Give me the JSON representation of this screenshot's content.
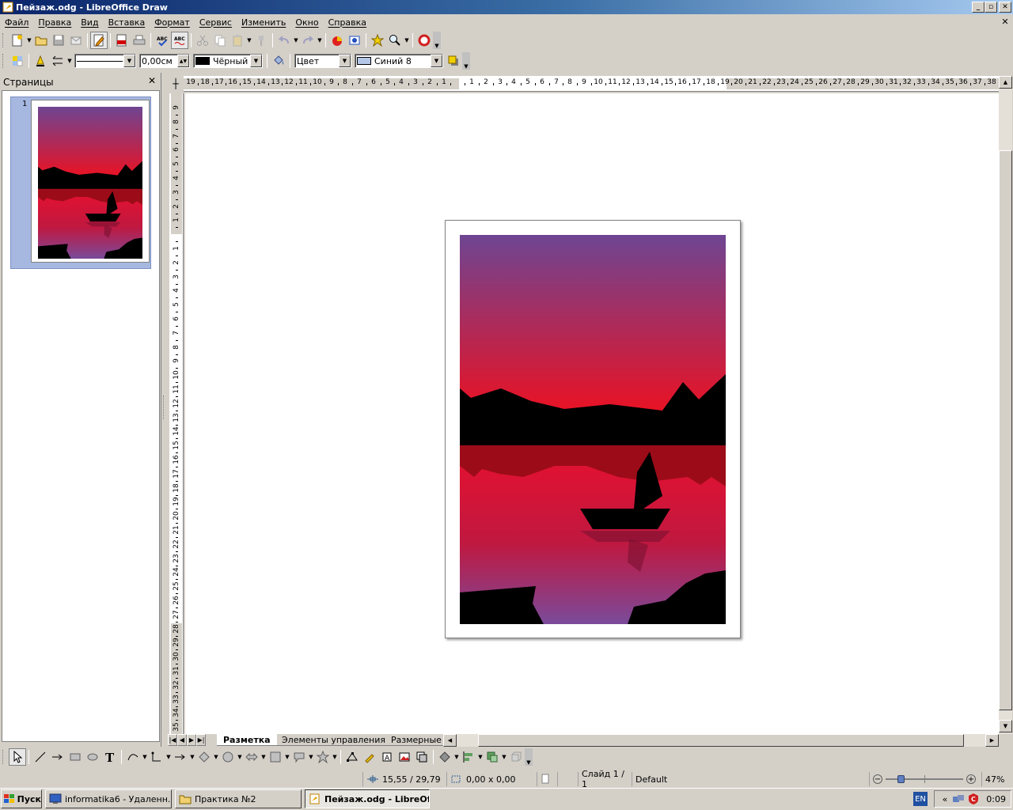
{
  "window": {
    "title": "Пейзаж.odg - LibreOffice Draw",
    "minimize_label": "_",
    "maximize_label": "▫",
    "close_label": "✕"
  },
  "menu": {
    "items": [
      "Файл",
      "Правка",
      "Вид",
      "Вставка",
      "Формат",
      "Сервис",
      "Изменить",
      "Окно",
      "Справка"
    ],
    "close_doc_label": "✕"
  },
  "toolbar2": {
    "line_style_value": "",
    "line_width_value": "0,00см",
    "line_color_value": "Чёрный",
    "line_color_hex": "#000000",
    "area_style_value": "Цвет",
    "area_fill_value": "Синий 8",
    "area_fill_hex": "#b4c7e7"
  },
  "pages_pane": {
    "title": "Страницы",
    "close_label": "✕",
    "pages": [
      {
        "number": "1"
      }
    ]
  },
  "hruler": {
    "labels": [
      "19",
      "18",
      "17",
      "16",
      "15",
      "14",
      "13",
      "12",
      "11",
      "10",
      "9",
      "8",
      "7",
      "6",
      "5",
      "4",
      "3",
      "2",
      "1",
      "",
      "1",
      "2",
      "3",
      "4",
      "5",
      "6",
      "7",
      "8",
      "9",
      "10",
      "11",
      "12",
      "13",
      "14",
      "15",
      "16",
      "17",
      "18",
      "19",
      "20",
      "21",
      "22",
      "23",
      "24",
      "25",
      "26",
      "27",
      "28",
      "29",
      "30",
      "31",
      "32",
      "33",
      "34",
      "35",
      "36",
      "37",
      "38"
    ]
  },
  "vruler": {
    "labels": [
      "9",
      "8",
      "7",
      "6",
      "5",
      "4",
      "3",
      "2",
      "1",
      "",
      "1",
      "2",
      "3",
      "4",
      "5",
      "6",
      "7",
      "8",
      "9",
      "10",
      "11",
      "12",
      "13",
      "14",
      "15",
      "16",
      "17",
      "18",
      "19",
      "20",
      "21",
      "22",
      "23",
      "24",
      "25",
      "26",
      "27",
      "28",
      "29",
      "30",
      "31",
      "32",
      "33",
      "34",
      "35"
    ]
  },
  "tabs": {
    "items": [
      "Разметка",
      "Элементы управления",
      "Размерные"
    ]
  },
  "status": {
    "position": "15,55 / 29,79",
    "size": "0,00 x 0,00",
    "slide": "Слайд 1 / 1",
    "layout": "Default",
    "zoom": "47%"
  },
  "taskbar": {
    "start_label": "Пуск",
    "tasks": [
      "informatika6 - Удаленн...",
      "Практика №2",
      "Пейзаж.odg - LibreOf..."
    ],
    "lang": "EN",
    "chevron": "«",
    "clock": "0:09"
  },
  "colors": {
    "sky_top": "#6e4592",
    "sky_bottom": "#ee1020",
    "water_top": "#e8102e",
    "water_bottom": "#7a4a9a",
    "reflection_band": "#9c0c18",
    "silhouette": "#000000"
  }
}
